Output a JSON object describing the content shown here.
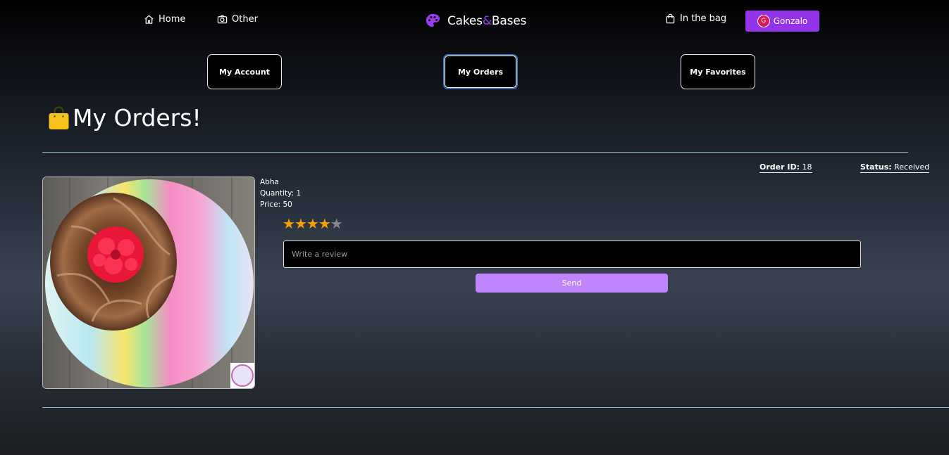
{
  "nav": {
    "home_label": "Home",
    "other_label": "Other",
    "brand_part1": "Cakes",
    "brand_amp": "&",
    "brand_part2": "Bases",
    "bag_label": "In the bag",
    "user_initial": "G",
    "user_name": "Gonzalo"
  },
  "tabs": {
    "account": "My Account",
    "orders": "My Orders",
    "favorites": "My Favorites",
    "active": "My Orders"
  },
  "page": {
    "title": "My Orders!",
    "title_icon": "shopping-bag-emoji"
  },
  "order": {
    "id_label": "Order ID:",
    "id_value": "18",
    "status_label": "Status:",
    "status_value": "Received",
    "product_name": "Abha",
    "quantity_text": "Quantity: 1",
    "price_text": "Price: 50",
    "rating": 4,
    "rating_max": 5,
    "review_placeholder": "Write a review",
    "send_label": "Send"
  },
  "colors": {
    "accent": "#9333ea",
    "send_button": "#c084fc",
    "star": "#f5a000",
    "divider": "#8fb3d6"
  }
}
